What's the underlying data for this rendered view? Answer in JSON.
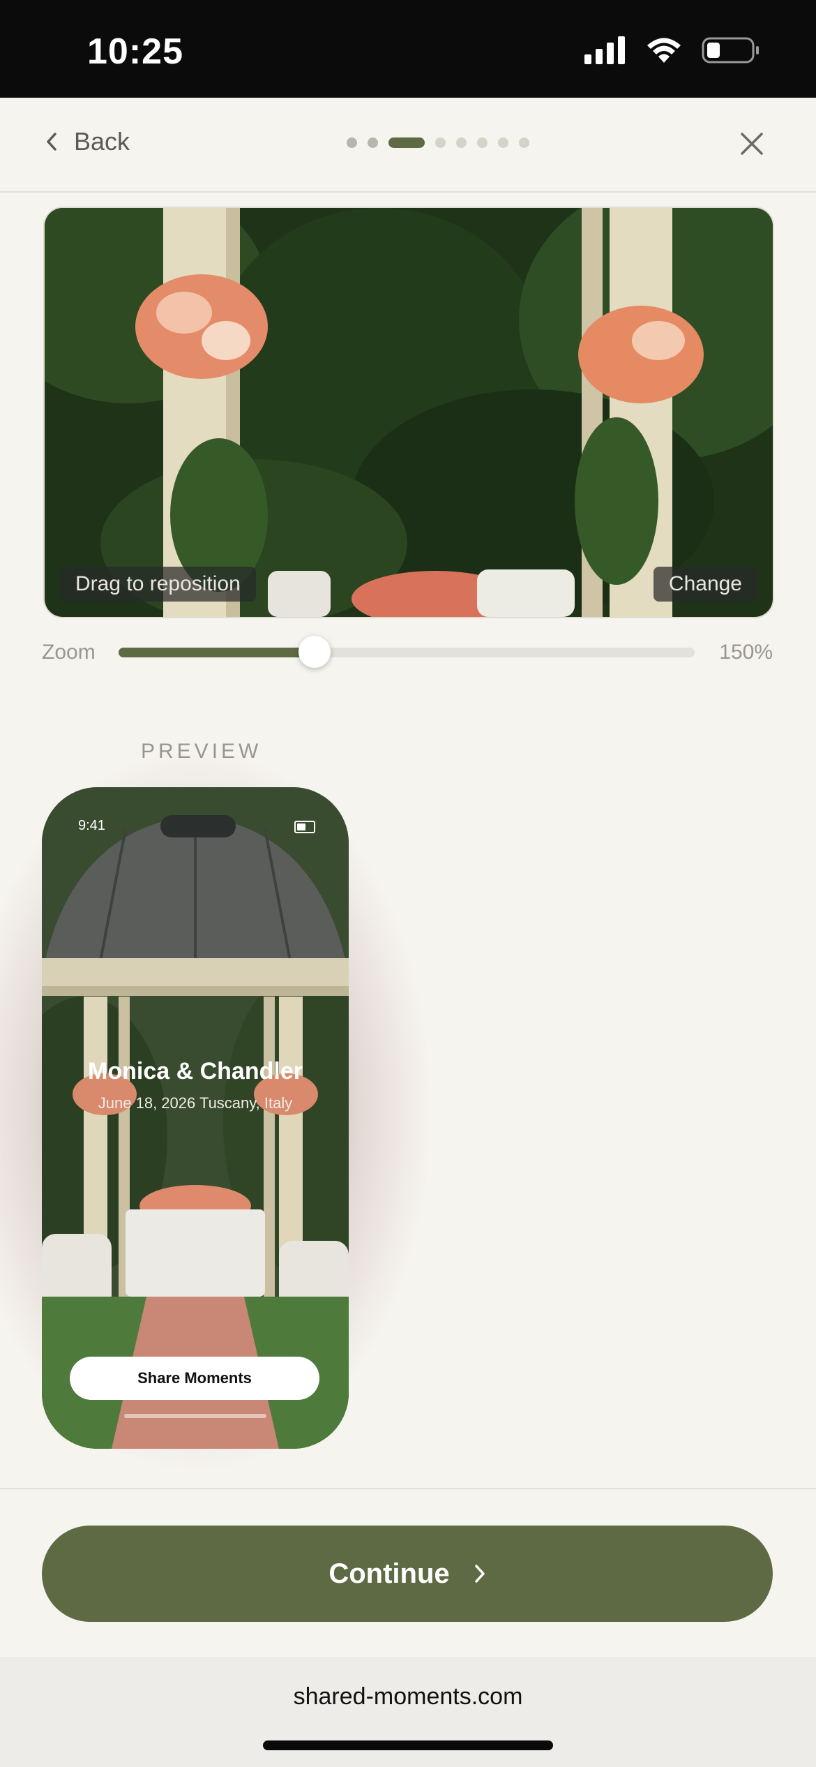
{
  "status_bar": {
    "time": "10:25",
    "icons": [
      "signal-icon",
      "wifi-icon",
      "battery-icon"
    ]
  },
  "header": {
    "back_label": "Back",
    "progress": {
      "total_steps": 8,
      "current_step": 3
    },
    "close_icon": "close-icon"
  },
  "editor": {
    "drag_hint": "Drag to reposition",
    "change_label": "Change",
    "zoom_label": "Zoom",
    "zoom_value": "150%",
    "zoom_fraction": 0.34
  },
  "preview": {
    "section_label": "PREVIEW",
    "phone_time": "9:41",
    "couple_names": "Monica & Chandler",
    "event_details": "June 18, 2026 Tuscany, Italy",
    "share_button": "Share Moments"
  },
  "footer": {
    "continue_label": "Continue"
  },
  "browser": {
    "url": "shared-moments.com"
  },
  "colors": {
    "accent": "#5d6a43",
    "background": "#f6f4ef",
    "status_bar": "#0b0b0b"
  }
}
